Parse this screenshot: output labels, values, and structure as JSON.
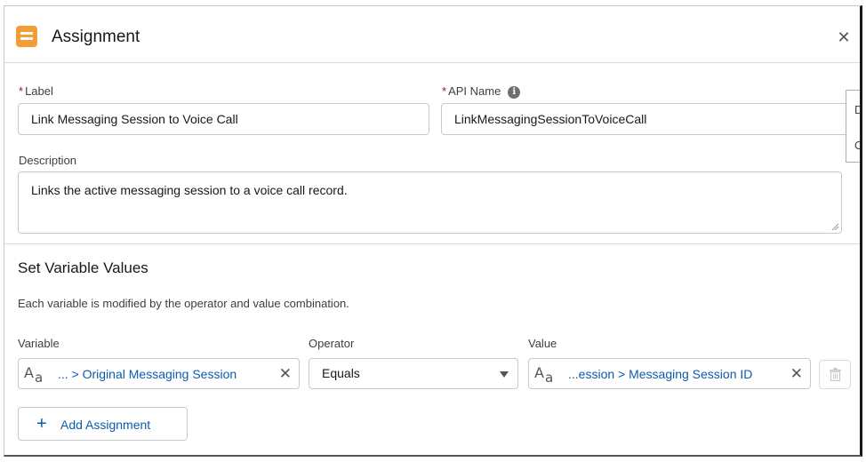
{
  "modal": {
    "title": "Assignment",
    "close_icon": "close-icon"
  },
  "form": {
    "label_field": {
      "label": "Label",
      "required_mark": "*",
      "value": "Link Messaging Session to Voice Call"
    },
    "api_name_field": {
      "label": "API Name",
      "required_mark": "*",
      "value": "LinkMessagingSessionToVoiceCall",
      "info_icon": "info-icon"
    },
    "description_field": {
      "label": "Description",
      "value": "Links the active messaging session to a voice call record."
    }
  },
  "side_popup": {
    "line1": "D",
    "line2": "C"
  },
  "assignments": {
    "section_title": "Set Variable Values",
    "hint": "Each variable is modified by the operator and value combination.",
    "variable_header": "Variable",
    "operator_header": "Operator",
    "value_header": "Value",
    "rows": [
      {
        "variable": "... > Original Messaging Session",
        "operator": "Equals",
        "value": "...ession > Messaging Session ID"
      }
    ],
    "add_button_label": "Add Assignment"
  },
  "colors": {
    "brand_icon": "#f49d37",
    "link": "#0b5cab",
    "required": "#ba0517"
  }
}
